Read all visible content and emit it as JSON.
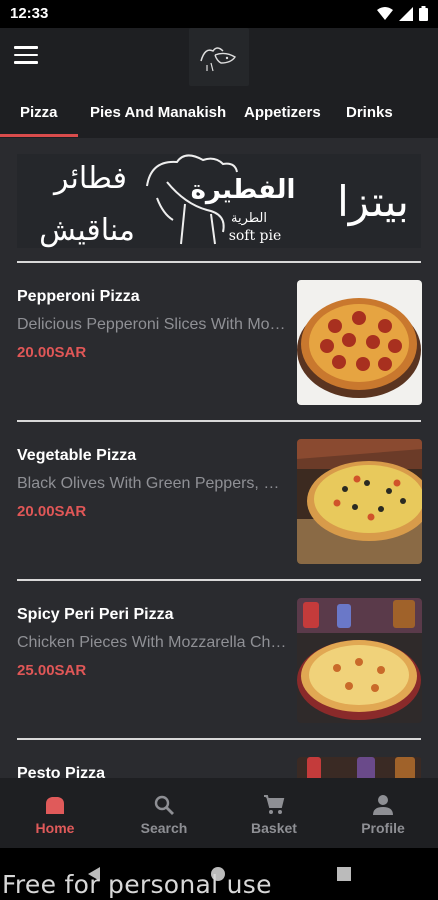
{
  "status": {
    "time": "12:33"
  },
  "header": {
    "logo_alt": "logo"
  },
  "tabs": [
    {
      "label": "Pizza",
      "active": true
    },
    {
      "label": "Pies And Manakish",
      "active": false
    },
    {
      "label": "Appetizers",
      "active": false
    },
    {
      "label": "Drinks",
      "active": false
    }
  ],
  "banner": {
    "left_top": "فطائر",
    "left_bottom": "مناقيش",
    "brand": "الفطيرة",
    "brand_sub": "الطرية",
    "brand_en": "soft pie",
    "right": "بيتزا"
  },
  "items": [
    {
      "name": "Pepperoni Pizza",
      "desc": "Delicious Pepperoni Slices With Mozzarella Cheese",
      "price": "20.00SAR"
    },
    {
      "name": "Vegetable Pizza",
      "desc": "Black Olives With Green Peppers, Mushrooms",
      "price": "20.00SAR"
    },
    {
      "name": "Spicy Peri Peri Pizza",
      "desc": "Chicken Pieces With Mozzarella Cheese",
      "price": "25.00SAR"
    },
    {
      "name": "Pesto Pizza",
      "desc": "",
      "price": ""
    }
  ],
  "bottom_nav": [
    {
      "label": "Home",
      "icon": "home-icon",
      "active": true
    },
    {
      "label": "Search",
      "icon": "search-icon",
      "active": false
    },
    {
      "label": "Basket",
      "icon": "cart-icon",
      "active": false
    },
    {
      "label": "Profile",
      "icon": "person-icon",
      "active": false
    }
  ],
  "watermark": "Free for personal use",
  "colors": {
    "accent": "#e05757",
    "background": "#2a2b2f",
    "bar": "#1e1f22"
  }
}
